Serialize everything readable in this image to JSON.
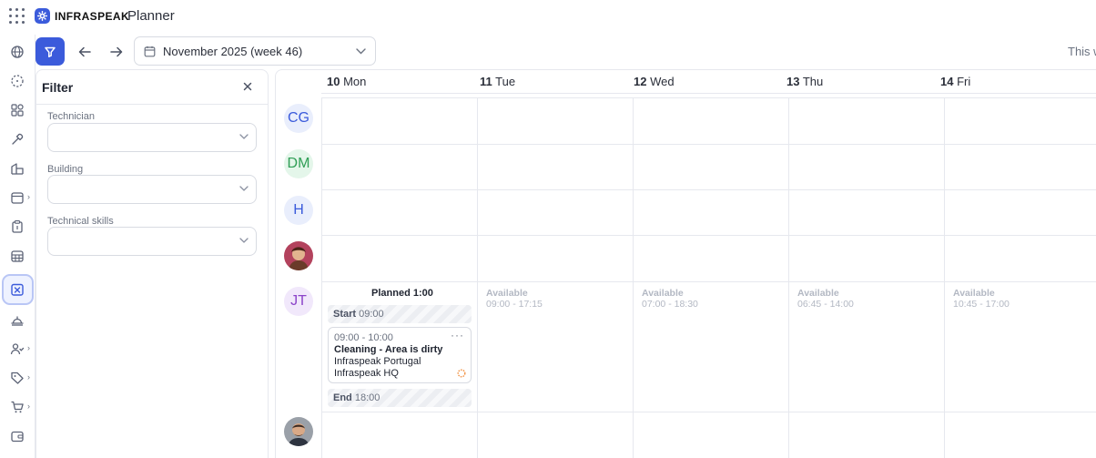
{
  "app": {
    "logo_text": "INFRASPEAK",
    "title": "Planner"
  },
  "toolbar": {
    "date_range": "November 2025 (week 46)",
    "this_week": "This w"
  },
  "filter": {
    "title": "Filter",
    "fields": [
      {
        "label": "Technician",
        "value": ""
      },
      {
        "label": "Building",
        "value": ""
      },
      {
        "label": "Technical skills",
        "value": ""
      }
    ]
  },
  "calendar": {
    "days": [
      {
        "num": "10",
        "name": "Mon"
      },
      {
        "num": "11",
        "name": "Tue"
      },
      {
        "num": "12",
        "name": "Wed"
      },
      {
        "num": "13",
        "name": "Thu"
      },
      {
        "num": "14",
        "name": "Fri"
      }
    ],
    "technicians": [
      {
        "initials": "CG"
      },
      {
        "initials": "DM"
      },
      {
        "initials": "H"
      },
      {
        "initials": ""
      },
      {
        "initials": "JT"
      },
      {
        "initials": ""
      }
    ],
    "jt_row": {
      "planned": "Planned 1:00",
      "start_label": "Start",
      "start_time": "09:00",
      "end_label": "End",
      "end_time": "18:00",
      "task": {
        "time": "09:00 - 10:00",
        "title": "Cleaning - Area is dirty",
        "client": "Infraspeak Portugal",
        "location": "Infraspeak HQ"
      },
      "availability": [
        {
          "label": "Available",
          "hours": "09:00 - 17:15"
        },
        {
          "label": "Available",
          "hours": "07:00 - 18:30"
        },
        {
          "label": "Available",
          "hours": "06:45 - 14:00"
        },
        {
          "label": "Available",
          "hours": "10:45 - 17:00"
        }
      ]
    }
  },
  "colors": {
    "accent": "#3b5bdb",
    "avatar_cg_bg": "#e9eefc",
    "avatar_cg_fg": "#3b5bdb",
    "avatar_dm_bg": "#e4f6ea",
    "avatar_dm_fg": "#2f9e55",
    "avatar_h_bg": "#e9eefc",
    "avatar_h_fg": "#3b5bdb",
    "avatar_jt_bg": "#f1e8fb",
    "avatar_jt_fg": "#8b43c9"
  }
}
